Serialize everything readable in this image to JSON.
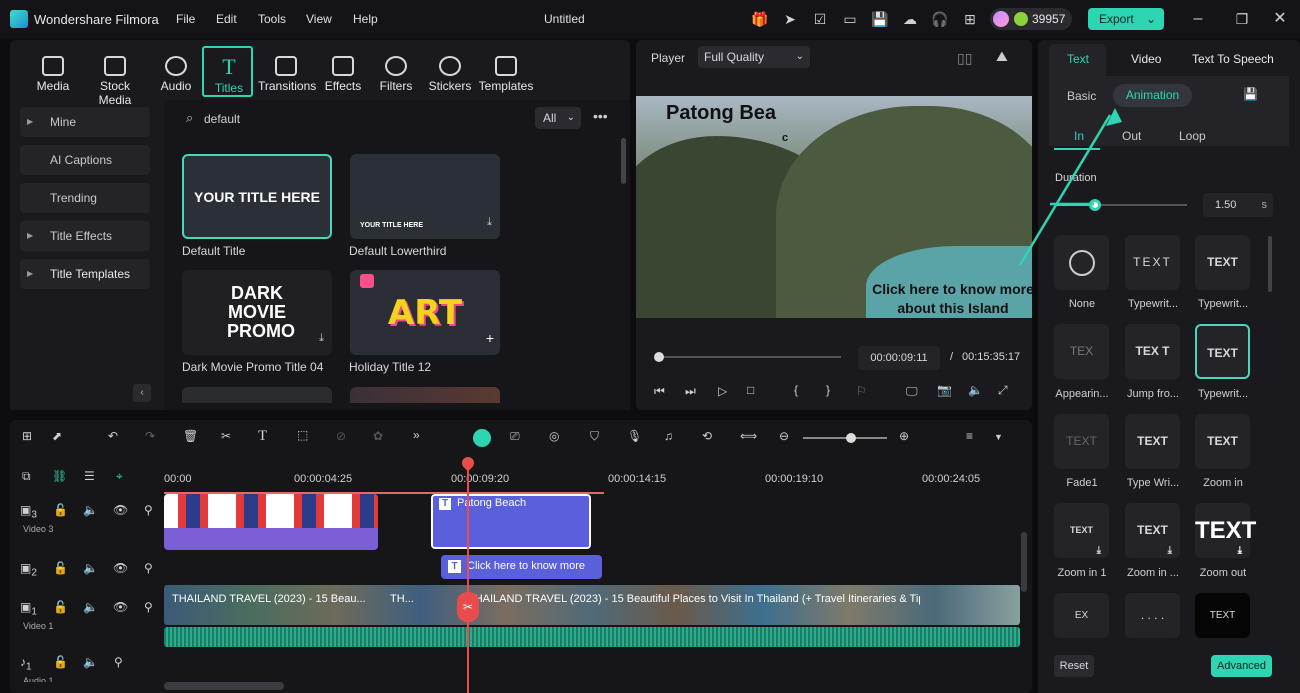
{
  "app": {
    "name": "Wondershare Filmora",
    "doc_title": "Untitled",
    "credits": "39957",
    "export_label": "Export"
  },
  "menu": [
    "File",
    "Edit",
    "Tools",
    "View",
    "Help"
  ],
  "media_tabs": [
    "Media",
    "Stock Media",
    "Audio",
    "Titles",
    "Transitions",
    "Effects",
    "Filters",
    "Stickers",
    "Templates"
  ],
  "sidebar": [
    "Mine",
    "AI Captions",
    "Trending",
    "Title Effects",
    "Title Templates"
  ],
  "search": {
    "value": "default",
    "filter": "All"
  },
  "cards": [
    {
      "thumb": "YOUR TITLE HERE",
      "label": "Default Title"
    },
    {
      "thumb": "YOUR TITLE HERE",
      "label": "Default Lowerthird"
    },
    {
      "thumb": "DARK MOVIE PROMO",
      "label": "Dark Movie Promo Title 04"
    },
    {
      "thumb": "ART",
      "label": "Holiday Title 12"
    }
  ],
  "player": {
    "label": "Player",
    "quality": "Full Quality",
    "overlay_title": "Patong Bea",
    "overlay_c": "c",
    "overlay_text": "Click here to know more about this Island",
    "current": "00:00:09:11",
    "sep": "/",
    "total": "00:15:35:17"
  },
  "ruler": [
    "00:00",
    "00:00:04:25",
    "00:00:09:20",
    "00:00:14:15",
    "00:00:19:10",
    "00:00:24:05"
  ],
  "tracks": {
    "video3": "Video 3",
    "video1": "Video 1",
    "audio1": "Audio 1",
    "clip_title": "Patong Beach",
    "clip_text": "Click here to know more",
    "clip_v1a": "THAILAND TRAVEL (2023) - 15 Beau...",
    "clip_v1b": "TH...",
    "clip_v1c": "THAILAND TRAVEL (2023) - 15 Beautiful Places to Visit In Thailand (+ Travel Itineraries & Tips)",
    "t3": "3",
    "t2": "2",
    "t1": "1",
    "a1": "1"
  },
  "right": {
    "tabs": [
      "Text",
      "Video",
      "Text To Speech"
    ],
    "sub": [
      "Basic",
      "Animation"
    ],
    "io": [
      "In",
      "Out",
      "Loop"
    ],
    "duration_label": "Duration",
    "duration_value": "1.50",
    "duration_unit": "s",
    "reset": "Reset",
    "advanced": "Advanced"
  },
  "presets": [
    {
      "thumb": "",
      "label": "None"
    },
    {
      "thumb": "TEXT",
      "label": "Typewrit..."
    },
    {
      "thumb": "TEXT",
      "label": "Typewrit..."
    },
    {
      "thumb": "TEX",
      "label": "Appearin..."
    },
    {
      "thumb": "TEX T",
      "label": "Jump fro..."
    },
    {
      "thumb": "TEXT",
      "label": "Typewrit..."
    },
    {
      "thumb": "TEXT",
      "label": "Fade1"
    },
    {
      "thumb": "TEXT",
      "label": "Type Wri..."
    },
    {
      "thumb": "TEXT",
      "label": "Zoom in"
    },
    {
      "thumb": "TEXT",
      "label": "Zoom in 1"
    },
    {
      "thumb": "TEXT",
      "label": "Zoom in ..."
    },
    {
      "thumb": "TEXT",
      "label": "Zoom out"
    },
    {
      "thumb": "EX",
      "label": ""
    },
    {
      "thumb": ". . . .",
      "label": ""
    },
    {
      "thumb": "TEXT",
      "label": ""
    }
  ]
}
